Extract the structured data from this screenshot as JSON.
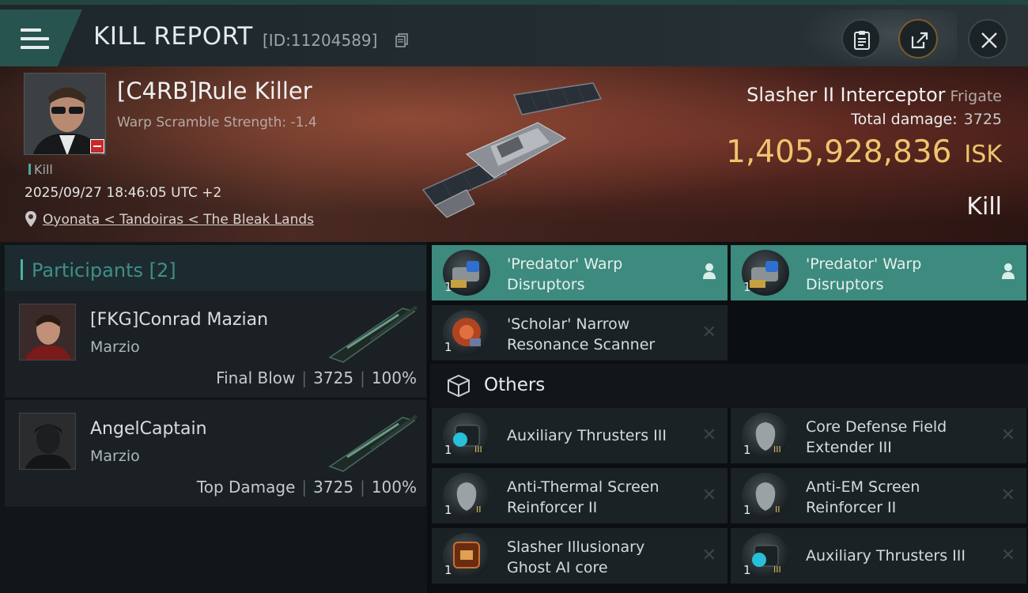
{
  "header": {
    "title": "KILL REPORT",
    "report_id": "[ID:11204589]",
    "buttons": [
      "clipboard-icon",
      "share-icon",
      "close-icon"
    ]
  },
  "victim": {
    "name": "[C4RB]Rule Killer",
    "scramble": "Warp Scramble Strength: -1.4",
    "kill_tag": "Kill",
    "datetime": "2025/09/27 18:46:05 UTC +2",
    "location": "Oyonata < Tandoiras < The Bleak Lands",
    "ship_name": "Slasher II Interceptor",
    "ship_class": "Frigate",
    "total_damage_label": "Total damage:",
    "total_damage": "3725",
    "isk_value": "1,405,928,836",
    "isk_unit": "ISK",
    "outcome": "Kill"
  },
  "participants": {
    "title": "Participants [2]",
    "rows": [
      {
        "name": "[FKG]Conrad Mazian",
        "ship": "Marzio",
        "role": "Final Blow",
        "damage": "3725",
        "percent": "100%"
      },
      {
        "name": "AngelCaptain",
        "ship": "Marzio",
        "role": "Top Damage",
        "damage": "3725",
        "percent": "100%"
      }
    ]
  },
  "modules": {
    "top": [
      {
        "qty": "1",
        "name": "'Predator' Warp Disruptors",
        "active": true
      },
      {
        "qty": "1",
        "name": "'Predator' Warp Disruptors",
        "active": true
      },
      {
        "qty": "1",
        "name": "'Scholar' Narrow Resonance Scanner",
        "active": false
      }
    ],
    "others_title": "Others",
    "others": [
      {
        "qty": "1",
        "name": "Auxiliary Thrusters III"
      },
      {
        "qty": "1",
        "name": "Core Defense Field Extender III"
      },
      {
        "qty": "1",
        "name": "Anti-Thermal Screen Reinforcer II"
      },
      {
        "qty": "1",
        "name": "Anti-EM Screen Reinforcer II"
      },
      {
        "qty": "1",
        "name": "Slasher Illusionary Ghost AI core"
      },
      {
        "qty": "1",
        "name": "Auxiliary Thrusters III"
      }
    ]
  },
  "colors": {
    "accent": "#3d8a7e",
    "isk": "#f0c46d",
    "teal_text": "#3f8f86"
  }
}
